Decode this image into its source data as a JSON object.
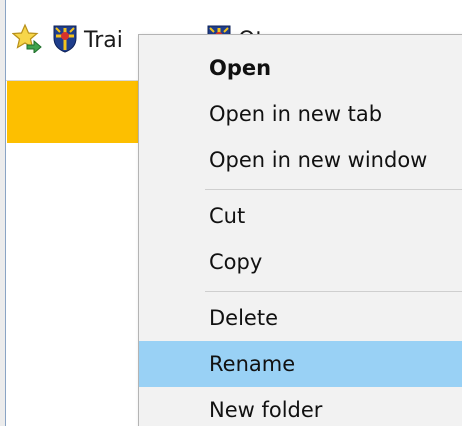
{
  "favorites_bar": {
    "items": [
      {
        "label": "",
        "icon": "add-favorite-star-icon"
      },
      {
        "label": "Trai",
        "icon": "crest-shield-icon"
      },
      {
        "label": "Ot",
        "icon": "crest-shield-icon"
      }
    ]
  },
  "page": {
    "band_color": "#fdbf00"
  },
  "context_menu": {
    "items": [
      {
        "label": "Open",
        "bold": true
      },
      {
        "label": "Open in new tab"
      },
      {
        "label": "Open in new window"
      },
      {
        "label": "Cut"
      },
      {
        "label": "Copy"
      },
      {
        "label": "Delete"
      },
      {
        "label": "Rename",
        "highlighted": true
      },
      {
        "label": "New folder"
      }
    ],
    "highlight_color": "#99d1f5"
  }
}
